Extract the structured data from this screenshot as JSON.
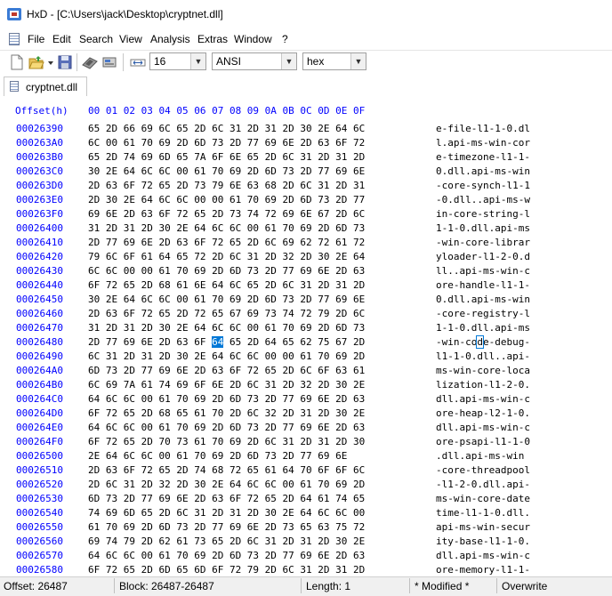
{
  "window": {
    "title": "HxD - [C:\\Users\\jack\\Desktop\\cryptnet.dll]"
  },
  "menu": [
    "File",
    "Edit",
    "Search",
    "View",
    "Analysis",
    "Extras",
    "Window",
    "?"
  ],
  "toolbar": {
    "icons": [
      "new-file-icon",
      "open-folder-icon",
      "dropdown-arrow-icon",
      "save-disk-icon",
      "ram-chip-icon",
      "disk-drive-icon",
      "columns-width-icon"
    ],
    "bytes_per_row": "16",
    "charset": "ANSI",
    "offset_base": "hex"
  },
  "tab": {
    "label": "cryptnet.dll"
  },
  "grid": {
    "header_offset": "Offset(h)",
    "header_cols": "00 01 02 03 04 05 06 07 08 09 0A 0B 0C 0D 0E 0F",
    "rows": [
      {
        "offset": "00026390",
        "hex": "65 2D 66 69 6C 65 2D 6C 31 2D 31 2D 30 2E 64 6C",
        "ascii": "e-file-l1-1-0.dl"
      },
      {
        "offset": "000263A0",
        "hex": "6C 00 61 70 69 2D 6D 73 2D 77 69 6E 2D 63 6F 72",
        "ascii": "l.api-ms-win-cor"
      },
      {
        "offset": "000263B0",
        "hex": "65 2D 74 69 6D 65 7A 6F 6E 65 2D 6C 31 2D 31 2D",
        "ascii": "e-timezone-l1-1-"
      },
      {
        "offset": "000263C0",
        "hex": "30 2E 64 6C 6C 00 61 70 69 2D 6D 73 2D 77 69 6E",
        "ascii": "0.dll.api-ms-win"
      },
      {
        "offset": "000263D0",
        "hex": "2D 63 6F 72 65 2D 73 79 6E 63 68 2D 6C 31 2D 31",
        "ascii": "-core-synch-l1-1"
      },
      {
        "offset": "000263E0",
        "hex": "2D 30 2E 64 6C 6C 00 00 61 70 69 2D 6D 73 2D 77",
        "ascii": "-0.dll..api-ms-w"
      },
      {
        "offset": "000263F0",
        "hex": "69 6E 2D 63 6F 72 65 2D 73 74 72 69 6E 67 2D 6C",
        "ascii": "in-core-string-l"
      },
      {
        "offset": "00026400",
        "hex": "31 2D 31 2D 30 2E 64 6C 6C 00 61 70 69 2D 6D 73",
        "ascii": "1-1-0.dll.api-ms"
      },
      {
        "offset": "00026410",
        "hex": "2D 77 69 6E 2D 63 6F 72 65 2D 6C 69 62 72 61 72",
        "ascii": "-win-core-librar"
      },
      {
        "offset": "00026420",
        "hex": "79 6C 6F 61 64 65 72 2D 6C 31 2D 32 2D 30 2E 64",
        "ascii": "yloader-l1-2-0.d"
      },
      {
        "offset": "00026430",
        "hex": "6C 6C 00 00 61 70 69 2D 6D 73 2D 77 69 6E 2D 63",
        "ascii": "ll..api-ms-win-c"
      },
      {
        "offset": "00026440",
        "hex": "6F 72 65 2D 68 61 6E 64 6C 65 2D 6C 31 2D 31 2D",
        "ascii": "ore-handle-l1-1-"
      },
      {
        "offset": "00026450",
        "hex": "30 2E 64 6C 6C 00 61 70 69 2D 6D 73 2D 77 69 6E",
        "ascii": "0.dll.api-ms-win"
      },
      {
        "offset": "00026460",
        "hex": "2D 63 6F 72 65 2D 72 65 67 69 73 74 72 79 2D 6C",
        "ascii": "-core-registry-l"
      },
      {
        "offset": "00026470",
        "hex": "31 2D 31 2D 30 2E 64 6C 6C 00 61 70 69 2D 6D 73",
        "ascii": "1-1-0.dll.api-ms"
      },
      {
        "offset": "00026480",
        "hex_pre": "2D 77 69 6E 2D 63 6F ",
        "hex_sel": "64",
        "hex_post": " 65 2D 64 65 62 75 67 2D",
        "ascii_pre": "-win-co",
        "ascii_sel": "d",
        "ascii_post": "e-debug-"
      },
      {
        "offset": "00026490",
        "hex": "6C 31 2D 31 2D 30 2E 64 6C 6C 00 00 61 70 69 2D",
        "ascii": "l1-1-0.dll..api-"
      },
      {
        "offset": "000264A0",
        "hex": "6D 73 2D 77 69 6E 2D 63 6F 72 65 2D 6C 6F 63 61",
        "ascii": "ms-win-core-loca"
      },
      {
        "offset": "000264B0",
        "hex": "6C 69 7A 61 74 69 6F 6E 2D 6C 31 2D 32 2D 30 2E",
        "ascii": "lization-l1-2-0."
      },
      {
        "offset": "000264C0",
        "hex": "64 6C 6C 00 61 70 69 2D 6D 73 2D 77 69 6E 2D 63",
        "ascii": "dll.api-ms-win-c"
      },
      {
        "offset": "000264D0",
        "hex": "6F 72 65 2D 68 65 61 70 2D 6C 32 2D 31 2D 30 2E",
        "ascii": "ore-heap-l2-1-0."
      },
      {
        "offset": "000264E0",
        "hex": "64 6C 6C 00 61 70 69 2D 6D 73 2D 77 69 6E 2D 63",
        "ascii": "dll.api-ms-win-c"
      },
      {
        "offset": "000264F0",
        "hex": "6F 72 65 2D 70 73 61 70 69 2D 6C 31 2D 31 2D 30",
        "ascii": "ore-psapi-l1-1-0"
      },
      {
        "offset": "00026500",
        "hex": "2E 64 6C 6C 00 61 70 69 2D 6D 73 2D 77 69 6E",
        "ascii": ".dll.api-ms-win"
      },
      {
        "offset": "00026510",
        "hex": "2D 63 6F 72 65 2D 74 68 72 65 61 64 70 6F 6F 6C",
        "ascii": "-core-threadpool"
      },
      {
        "offset": "00026520",
        "hex": "2D 6C 31 2D 32 2D 30 2E 64 6C 6C 00 61 70 69 2D",
        "ascii": "-l1-2-0.dll.api-"
      },
      {
        "offset": "00026530",
        "hex": "6D 73 2D 77 69 6E 2D 63 6F 72 65 2D 64 61 74 65",
        "ascii": "ms-win-core-date"
      },
      {
        "offset": "00026540",
        "hex": "74 69 6D 65 2D 6C 31 2D 31 2D 30 2E 64 6C 6C 00",
        "ascii": "time-l1-1-0.dll."
      },
      {
        "offset": "00026550",
        "hex": "61 70 69 2D 6D 73 2D 77 69 6E 2D 73 65 63 75 72",
        "ascii": "api-ms-win-secur"
      },
      {
        "offset": "00026560",
        "hex": "69 74 79 2D 62 61 73 65 2D 6C 31 2D 31 2D 30 2E",
        "ascii": "ity-base-l1-1-0."
      },
      {
        "offset": "00026570",
        "hex": "64 6C 6C 00 61 70 69 2D 6D 73 2D 77 69 6E 2D 63",
        "ascii": "dll.api-ms-win-c"
      },
      {
        "offset": "00026580",
        "hex": "6F 72 65 2D 6D 65 6D 6F 72 79 2D 6C 31 2D 31 2D",
        "ascii": "ore-memory-l1-1-"
      }
    ]
  },
  "status": {
    "offset": "Offset: 26487",
    "block": "Block: 26487-26487",
    "length": "Length: 1",
    "modified": "* Modified *",
    "mode": "Overwrite"
  },
  "colors": {
    "offset_blue": "#0000ff",
    "selection": "#0078d7"
  }
}
